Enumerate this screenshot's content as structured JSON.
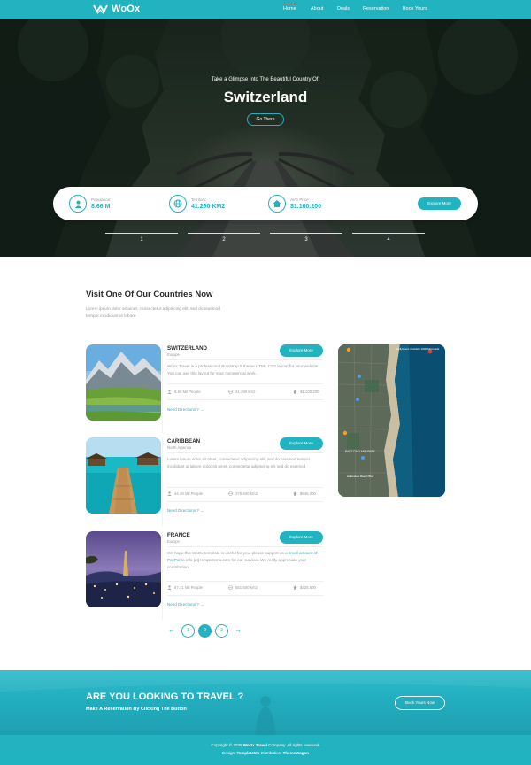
{
  "brand": {
    "name": "WoOx"
  },
  "nav": {
    "items": [
      {
        "label": "Home",
        "active": true
      },
      {
        "label": "About",
        "active": false
      },
      {
        "label": "Deals",
        "active": false
      },
      {
        "label": "Reservation",
        "active": false
      },
      {
        "label": "Book Yours",
        "active": false
      }
    ]
  },
  "hero": {
    "subtitle": "Take a Glimpse Into The Beautiful Country Of:",
    "title": "Switzerland",
    "button": "Go There",
    "stats": [
      {
        "label": "Population:",
        "value": "8.66 M",
        "icon": "user-icon"
      },
      {
        "label": "Territory:",
        "value": "41.290 KM2",
        "icon": "globe-icon"
      },
      {
        "label": "AVG Price:",
        "value": "$1.100.200",
        "icon": "home-icon"
      }
    ],
    "explore_button": "Explore More",
    "slides": [
      "1",
      "2",
      "3",
      "4"
    ]
  },
  "section": {
    "title": "Visit One Of Our Countries Now",
    "description": "Lorem ipsum dolor sit amet, consectetur adipiscing elit, sed do eiusmod tempor incididunt ut labore"
  },
  "countries": [
    {
      "name": "SWITZERLAND",
      "region": "Europe",
      "button": "Explore More",
      "desc": "Woox Travel is a professional Bootstrap 5 theme HTML CSS layout for your website. You can use this layout for your commercial work.",
      "people": "8.66 Mil People",
      "area": "41.290 km2",
      "price": "$1.100.200",
      "directions": "Need Directions ?"
    },
    {
      "name": "CARIBBEAN",
      "region": "North America",
      "button": "Explore More",
      "desc": "Lorem ipsum dolor sit amet, consectetur adipiscing elit, sed do eiusmod tempor incididunt ut labore dolor sit amet, consectetur adipiscing elit sed do eiusmod.",
      "people": "44.48 Mil People",
      "area": "275.400 km2",
      "price": "$946.000",
      "directions": "Need Directions ?"
    },
    {
      "name": "FRANCE",
      "region": "Europe",
      "button": "Explore More",
      "desc_before": "We hope this WoOx template is useful for you, please support us a ",
      "desc_link": "small amount of PayPal",
      "desc_after": " to info [at] templatemo.com for our survival. We really appreciate your contribution.",
      "people": "67.41 Mil People",
      "area": "551.500 km2",
      "price": "$425.600",
      "directions": "Need Directions ?"
    }
  ],
  "map": {
    "labels": [
      "Hollywood, Florida's 1000 Mermaids",
      "EAST OAKLAND PARK",
      "Hallandale Beach Blvd"
    ]
  },
  "pagination": {
    "prev": "←",
    "pages": [
      "1",
      "2",
      "3"
    ],
    "active": "2",
    "next": "→"
  },
  "cta": {
    "title": "ARE YOU LOOKING TO TRAVEL ?",
    "subtitle": "Make A Reservation By Clicking The Button",
    "button": "Book Yours Now"
  },
  "footer": {
    "copyright_before": "Copyright © 2036 ",
    "copyright_brand": "WoOx Travel",
    "copyright_after": " Company. All rights reserved.",
    "design_before": "Design: ",
    "design_by": "TemplateMo",
    "dist_before": " Distribution: ",
    "dist_by": "ThemeWagon"
  },
  "colors": {
    "accent": "#22b3c1",
    "text": "#2a2a2a",
    "muted": "#9a9a9a"
  }
}
